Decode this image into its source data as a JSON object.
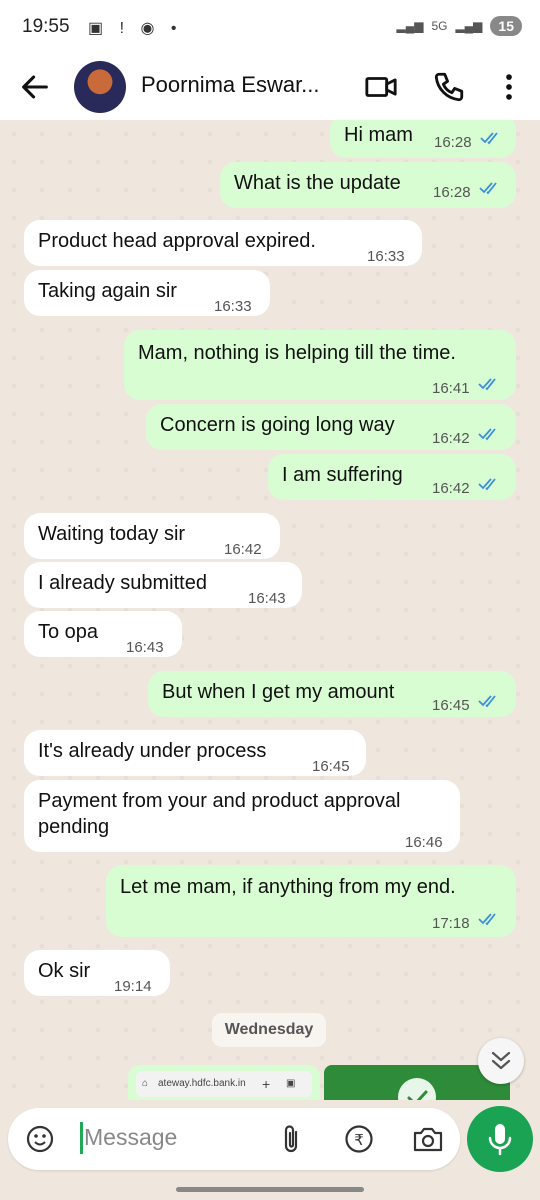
{
  "status_bar": {
    "time": "19:55",
    "network": "5G",
    "battery": "15"
  },
  "header": {
    "contact_name": "Poornima Eswar..."
  },
  "messages": [
    {
      "text": "Hi mam",
      "time": "16:28",
      "dir": "out"
    },
    {
      "text": "What is the update",
      "time": "16:28",
      "dir": "out"
    },
    {
      "text": "Product head approval expired.",
      "time": "16:33",
      "dir": "in"
    },
    {
      "text": "Taking again sir",
      "time": "16:33",
      "dir": "in"
    },
    {
      "text": "Mam, nothing is helping till the time.",
      "time": "16:41",
      "dir": "out"
    },
    {
      "text": "Concern is going long way",
      "time": "16:42",
      "dir": "out"
    },
    {
      "text": "I am suffering",
      "time": "16:42",
      "dir": "out"
    },
    {
      "text": "Waiting today sir",
      "time": "16:42",
      "dir": "in"
    },
    {
      "text": "I already submitted",
      "time": "16:43",
      "dir": "in"
    },
    {
      "text": "To opa",
      "time": "16:43",
      "dir": "in"
    },
    {
      "text": "But when I get my amount",
      "time": "16:45",
      "dir": "out"
    },
    {
      "text": "It's already under process",
      "time": "16:45",
      "dir": "in"
    },
    {
      "text": "Payment from your and product approval pending",
      "time": "16:46",
      "dir": "in"
    },
    {
      "text": "Let me mam, if anything from my end.",
      "time": "17:18",
      "dir": "out"
    },
    {
      "text": "Ok sir",
      "time": "19:14",
      "dir": "in"
    }
  ],
  "day_separator": "Wednesday",
  "preview": {
    "url": "ateway.hdfc.bank.in"
  },
  "input": {
    "placeholder": "Message"
  },
  "colors": {
    "outgoing_bubble": "#d9fdd3",
    "incoming_bubble": "#ffffff",
    "chat_bg": "#efe7de",
    "accent": "#1aa352",
    "read_tick": "#3b8fd9"
  }
}
